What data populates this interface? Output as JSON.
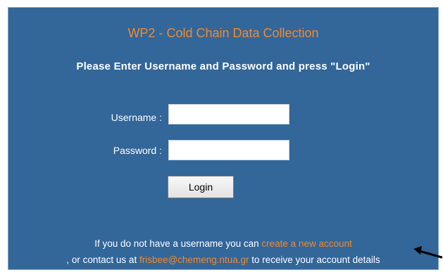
{
  "title": "WP2 - Cold Chain Data Collection",
  "subtitle": "Please Enter Username and Password and press \"Login\"",
  "form": {
    "username_label": "Username :",
    "password_label": "Password :",
    "username_value": "",
    "password_value": "",
    "login_label": "Login"
  },
  "footer": {
    "line1_text": "If you do not have a username you can ",
    "create_account_link": "create a new account",
    "line2_prefix": ", or contact us at ",
    "email_link": "frisbee@chemeng.ntua.gr",
    "line2_suffix": " to receive your account details"
  },
  "colors": {
    "panel_bg": "#336699",
    "accent_orange": "#f28a2b",
    "text_white": "#ffffff"
  },
  "icons": {
    "annotation_arrow": "arrow-icon"
  }
}
